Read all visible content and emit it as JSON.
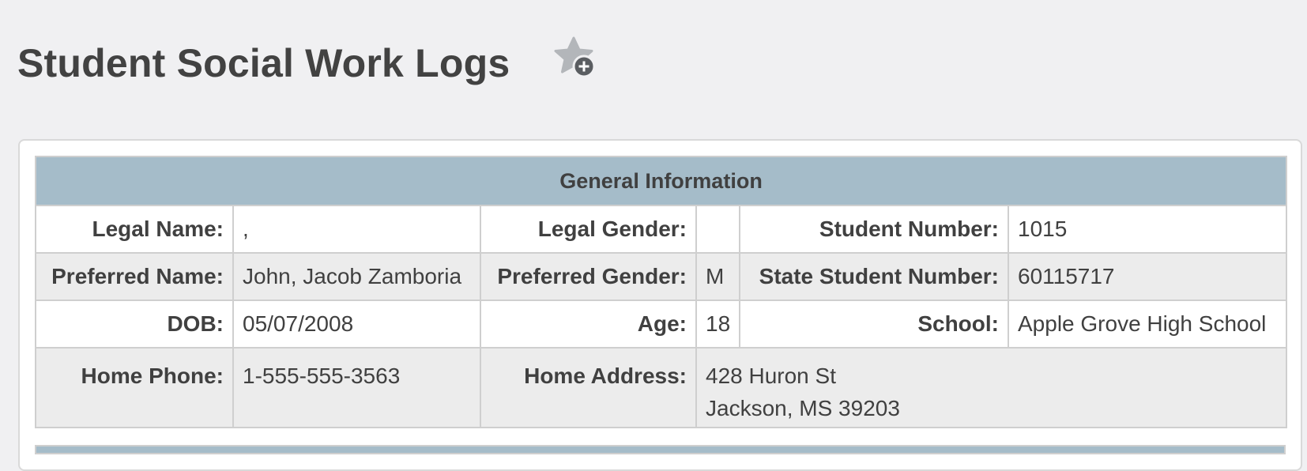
{
  "page": {
    "title": "Student Social Work Logs",
    "favorite_icon": "star-plus-icon"
  },
  "general_info": {
    "heading": "General Information",
    "rows": [
      {
        "legal_name_label": "Legal Name:",
        "legal_name_value": ",",
        "legal_gender_label": "Legal Gender:",
        "legal_gender_value": "",
        "student_number_label": "Student Number:",
        "student_number_value": "1015"
      },
      {
        "preferred_name_label": "Preferred Name:",
        "preferred_name_value": "John, Jacob Zamboria",
        "preferred_gender_label": "Preferred Gender:",
        "preferred_gender_value": "M",
        "state_student_number_label": "State Student Number:",
        "state_student_number_value": "60115717"
      },
      {
        "dob_label": "DOB:",
        "dob_value": "05/07/2008",
        "age_label": "Age:",
        "age_value": "18",
        "school_label": "School:",
        "school_value": "Apple Grove High School"
      },
      {
        "home_phone_label": "Home Phone:",
        "home_phone_value": "1-555-555-3563",
        "home_address_label": "Home Address:",
        "home_address_line1": "428 Huron St",
        "home_address_line2": "Jackson, MS 39203"
      }
    ]
  },
  "colors": {
    "page_background": "#f0f0f2",
    "header_band": "#a5bcc9",
    "alt_row": "#ececec",
    "text": "#404040"
  }
}
